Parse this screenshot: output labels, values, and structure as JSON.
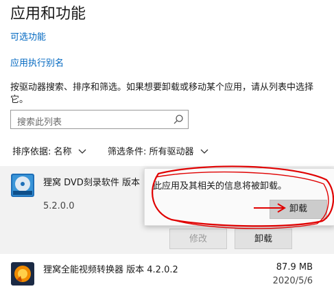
{
  "page": {
    "title": "应用和功能"
  },
  "links": {
    "optional_features": "可选功能",
    "app_execution_aliases": "应用执行别名"
  },
  "description": "按驱动器搜索、排序和筛选。如果想要卸载或移动某个应用，请从列表中选择它。",
  "search": {
    "placeholder": "搜索此列表",
    "icon": "search-icon"
  },
  "sort": {
    "label": "排序依据:",
    "value": "名称"
  },
  "filter": {
    "label": "筛选条件:",
    "value": "所有驱动器"
  },
  "apps": [
    {
      "name": "狸窝 DVD刻录软件 版本",
      "version": "5.2.0.0",
      "buttons": {
        "modify": "修改",
        "uninstall": "卸载"
      }
    },
    {
      "name": "狸窝全能视频转换器 版本  4.2.0.2",
      "size": "87.9 MB",
      "date": "2020/5/6"
    }
  ],
  "popup": {
    "message": "此应用及其相关的信息将被卸载。",
    "confirm_label": "卸载"
  },
  "colors": {
    "link": "#0067c0",
    "annotation": "#e00000",
    "panel": "#f2f2f2"
  }
}
